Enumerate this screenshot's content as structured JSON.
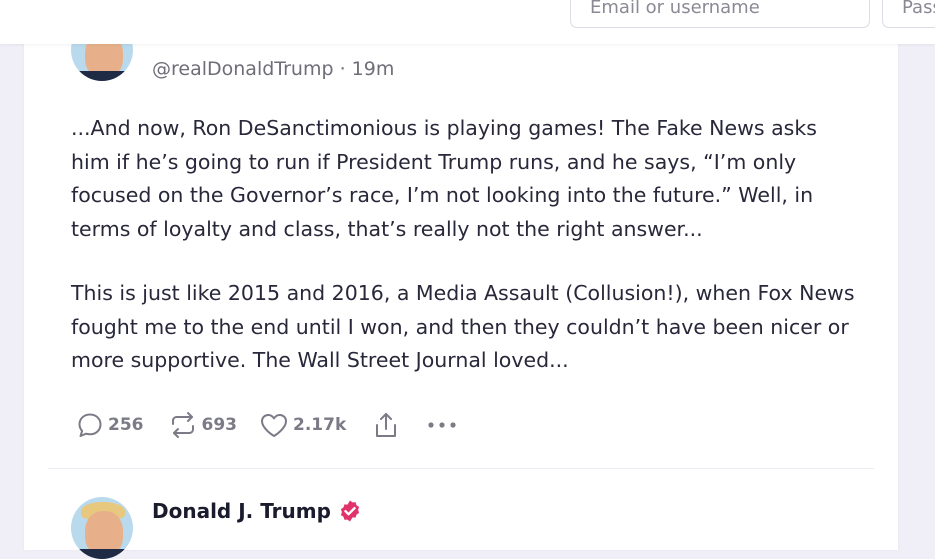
{
  "header": {
    "email_placeholder": "Email or username",
    "password_placeholder": "Password"
  },
  "post": {
    "handle": "@realDonaldTrump",
    "separator": "·",
    "time": "19m",
    "paragraphs": [
      "...And now, Ron DeSanctimonious is playing games! The Fake News asks him if he’s going to run if President Trump runs, and he says, “I’m only focused on the Governor’s race, I’m not looking into the future.” Well, in terms of loyalty and class, that’s really not the right answer...",
      "This is just like 2015 and 2016, a Media Assault (Collusion!), when Fox News fought me to the end until I won, and then they couldn’t have been nicer or more supportive. The Wall Street Journal loved..."
    ],
    "actions": {
      "replies": "256",
      "retruths": "693",
      "likes": "2.17k"
    },
    "icons": [
      "reply-icon",
      "retruth-icon",
      "like-icon",
      "share-icon",
      "more-icon"
    ]
  },
  "next_post": {
    "display_name": "Donald J. Trump",
    "verified_icon": "verified-badge-icon",
    "verified_color": "#e0336c"
  },
  "colors": {
    "page_background": "#f0eff8",
    "text": "#28283a",
    "muted": "#7b7b87"
  }
}
